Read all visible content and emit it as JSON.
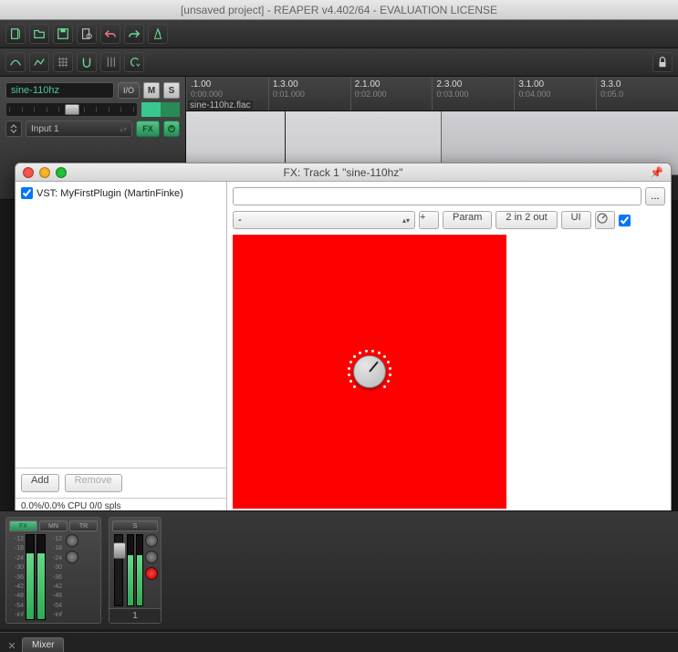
{
  "colors": {
    "plugin_bg": "#ff0000",
    "accent_green": "#2a8a55"
  },
  "main_window": {
    "title": "[unsaved project] - REAPER v4.402/64 - EVALUATION LICENSE"
  },
  "ruler": [
    {
      "bar": ".1.00",
      "time": "0:00.000"
    },
    {
      "bar": "1.3.00",
      "time": "0:01.000"
    },
    {
      "bar": "2.1.00",
      "time": "0:02.000"
    },
    {
      "bar": "2.3.00",
      "time": "0:03.000"
    },
    {
      "bar": "3.1.00",
      "time": "0:04.000"
    },
    {
      "bar": "3.3.0",
      "time": "0:05.0"
    }
  ],
  "track": {
    "name": "sine-110hz",
    "io_label": "I/O",
    "mute": "M",
    "solo": "S",
    "input": "Input 1",
    "fx_label": "FX",
    "number": "1"
  },
  "clip": {
    "label": "sine-110hz.flac"
  },
  "fx_window": {
    "title": "FX: Track 1 \"sine-110hz\"",
    "list_item": "VST: MyFirstPlugin (MartinFinke)",
    "add": "Add",
    "remove": "Remove",
    "status": "0.0%/0.0% CPU 0/0 spls",
    "compare": "-",
    "plus": "+",
    "param": "Param",
    "io": "2 in 2 out",
    "ui": "UI",
    "browse": "..."
  },
  "mixer": {
    "master_fx": "FX",
    "master_mono": "MN",
    "scale": [
      "-12",
      "-18",
      "-24",
      "-30",
      "-36",
      "-42",
      "-48",
      "-54",
      "-inf"
    ],
    "strip2_num": "1",
    "solo": "S"
  },
  "tabs": {
    "mixer": "Mixer"
  }
}
